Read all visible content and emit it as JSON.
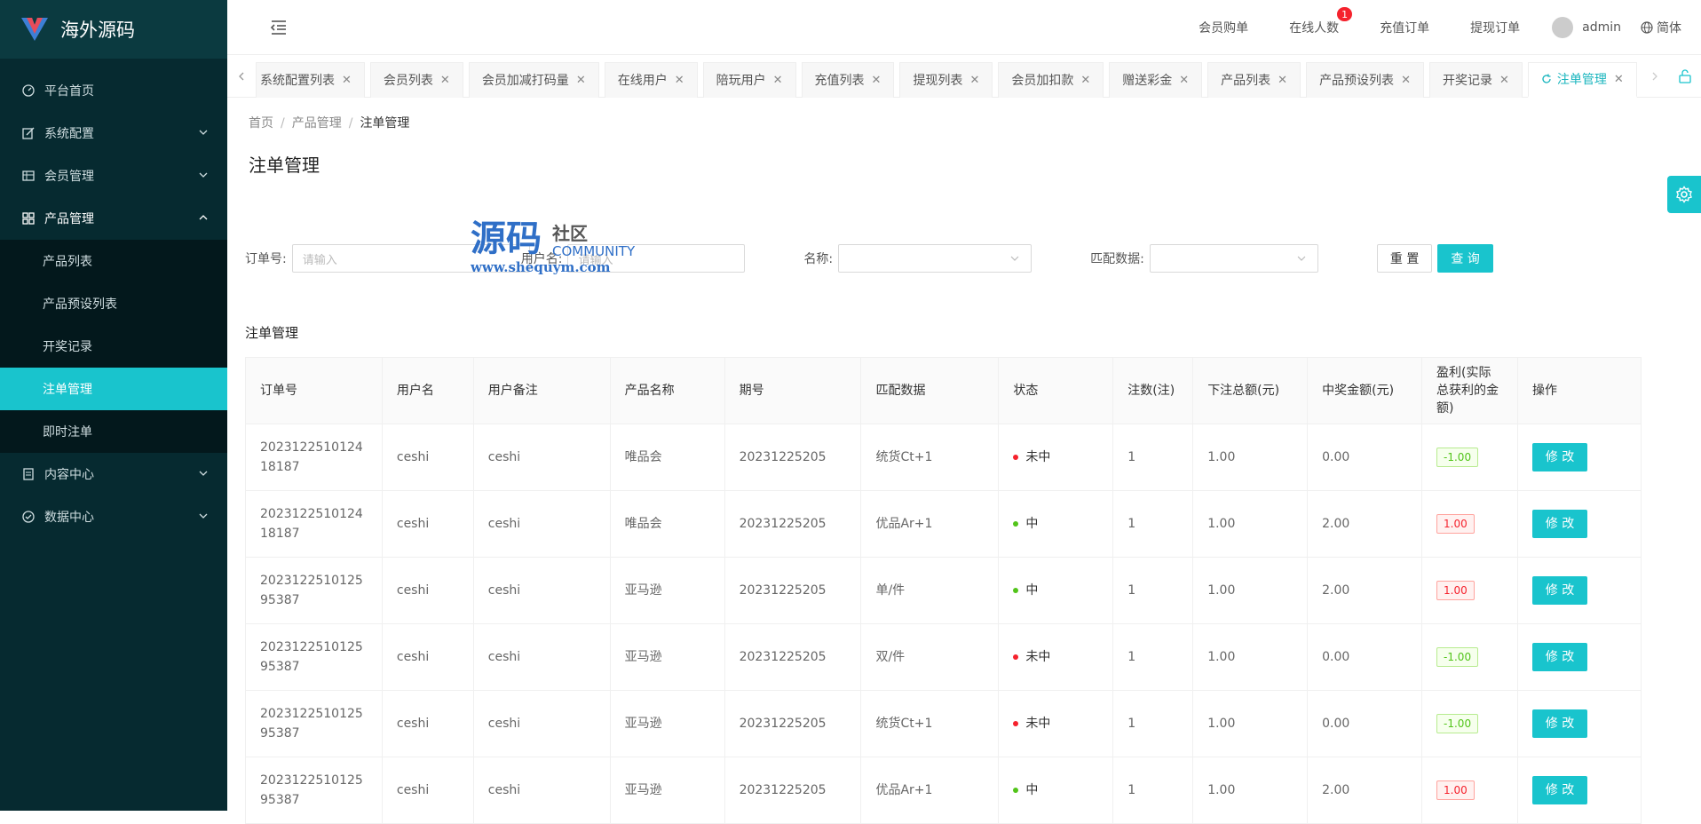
{
  "brand": {
    "title": "海外源码"
  },
  "sidebar": {
    "items": [
      {
        "label": "平台首页",
        "icon": "dashboard-icon"
      },
      {
        "label": "系统配置",
        "icon": "edit-icon"
      },
      {
        "label": "会员管理",
        "icon": "table-icon"
      },
      {
        "label": "产品管理",
        "icon": "grid-icon"
      },
      {
        "label": "内容中心",
        "icon": "document-icon"
      },
      {
        "label": "数据中心",
        "icon": "check-circle-icon"
      }
    ],
    "submenu": [
      {
        "label": "产品列表"
      },
      {
        "label": "产品预设列表"
      },
      {
        "label": "开奖记录"
      },
      {
        "label": "注单管理"
      },
      {
        "label": "即时注单"
      }
    ]
  },
  "header": {
    "links": [
      "会员购单",
      "在线人数",
      "充值订单",
      "提现订单"
    ],
    "online_badge": "1",
    "user": "admin",
    "lang": "简体"
  },
  "tabs": [
    "系统配置列表",
    "会员列表",
    "会员加减打码量",
    "在线用户",
    "陪玩用户",
    "充值列表",
    "提现列表",
    "会员加扣款",
    "赠送彩金",
    "产品列表",
    "产品预设列表",
    "开奖记录",
    "注单管理"
  ],
  "breadcrumb": [
    "首页",
    "产品管理",
    "注单管理"
  ],
  "page_title": "注单管理",
  "filters": {
    "order_label": "订单号:",
    "order_placeholder": "请输入",
    "user_label": "用户名:",
    "user_placeholder": "请输入",
    "name_label": "名称:",
    "match_label": "匹配数据:",
    "reset": "重 置",
    "query": "查 询"
  },
  "watermark": {
    "main": "源码",
    "side": "社区",
    "en": "COMMUNITY",
    "url": "www.shequym.com"
  },
  "section_title": "注单管理",
  "table": {
    "headers": [
      "订单号",
      "用户名",
      "用户备注",
      "产品名称",
      "期号",
      "匹配数据",
      "状态",
      "注数(注)",
      "下注总额(元)",
      "中奖金额(元)",
      "盈利(实际总获利的金额)",
      "操作"
    ],
    "rows": [
      {
        "order": "202312251012418187",
        "user": "ceshi",
        "note": "ceshi",
        "product": "唯品会",
        "period": "20231225205",
        "match": "统货Ct+1",
        "status": "未中",
        "status_color": "#f5222d",
        "count": "1",
        "total": "1.00",
        "win": "0.00",
        "profit": "-1.00",
        "profit_type": "neg",
        "action": "修 改"
      },
      {
        "order": "202312251012418187",
        "user": "ceshi",
        "note": "ceshi",
        "product": "唯品会",
        "period": "20231225205",
        "match": "优品Ar+1",
        "status": "中",
        "status_color": "#52c41a",
        "count": "1",
        "total": "1.00",
        "win": "2.00",
        "profit": "1.00",
        "profit_type": "pos",
        "action": "修 改"
      },
      {
        "order": "202312251012595387",
        "user": "ceshi",
        "note": "ceshi",
        "product": "亚马逊",
        "period": "20231225205",
        "match": "单/件",
        "status": "中",
        "status_color": "#52c41a",
        "count": "1",
        "total": "1.00",
        "win": "2.00",
        "profit": "1.00",
        "profit_type": "pos",
        "action": "修 改"
      },
      {
        "order": "202312251012595387",
        "user": "ceshi",
        "note": "ceshi",
        "product": "亚马逊",
        "period": "20231225205",
        "match": "双/件",
        "status": "未中",
        "status_color": "#f5222d",
        "count": "1",
        "total": "1.00",
        "win": "0.00",
        "profit": "-1.00",
        "profit_type": "neg",
        "action": "修 改"
      },
      {
        "order": "202312251012595387",
        "user": "ceshi",
        "note": "ceshi",
        "product": "亚马逊",
        "period": "20231225205",
        "match": "统货Ct+1",
        "status": "未中",
        "status_color": "#f5222d",
        "count": "1",
        "total": "1.00",
        "win": "0.00",
        "profit": "-1.00",
        "profit_type": "neg",
        "action": "修 改"
      },
      {
        "order": "202312251012595387",
        "user": "ceshi",
        "note": "ceshi",
        "product": "亚马逊",
        "period": "20231225205",
        "match": "优品Ar+1",
        "status": "中",
        "status_color": "#52c41a",
        "count": "1",
        "total": "1.00",
        "win": "2.00",
        "profit": "1.00",
        "profit_type": "pos",
        "action": "修 改"
      }
    ]
  },
  "colors": {
    "accent": "#19c4cd",
    "sidebar_bg": "#062a30",
    "submenu_bg": "#03181c"
  }
}
